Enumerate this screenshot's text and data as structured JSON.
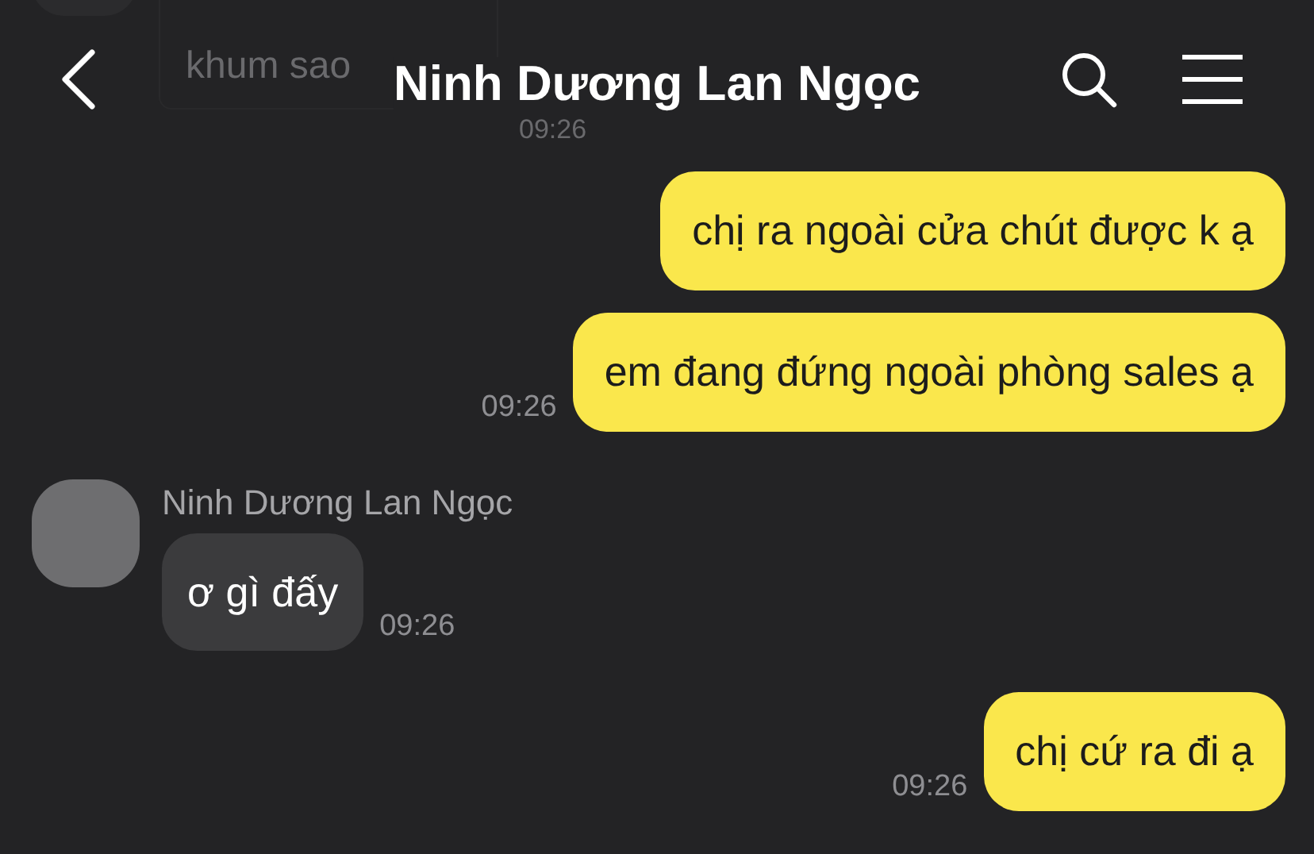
{
  "header": {
    "title": "Ninh Dương Lan Ngọc"
  },
  "faded_message": {
    "text": "khum sao",
    "time": "09:26"
  },
  "messages": [
    {
      "kind": "sent",
      "text": "chị ra ngoài cửa chút được k ạ"
    },
    {
      "kind": "sent",
      "text": "em đang đứng ngoài phòng sales ạ",
      "time": "09:26"
    },
    {
      "kind": "received",
      "sender": "Ninh Dương Lan Ngọc",
      "text": "ơ gì đấy",
      "time": "09:26"
    },
    {
      "kind": "sent",
      "text": "chị cứ ra đi ạ",
      "time": "09:26"
    }
  ]
}
